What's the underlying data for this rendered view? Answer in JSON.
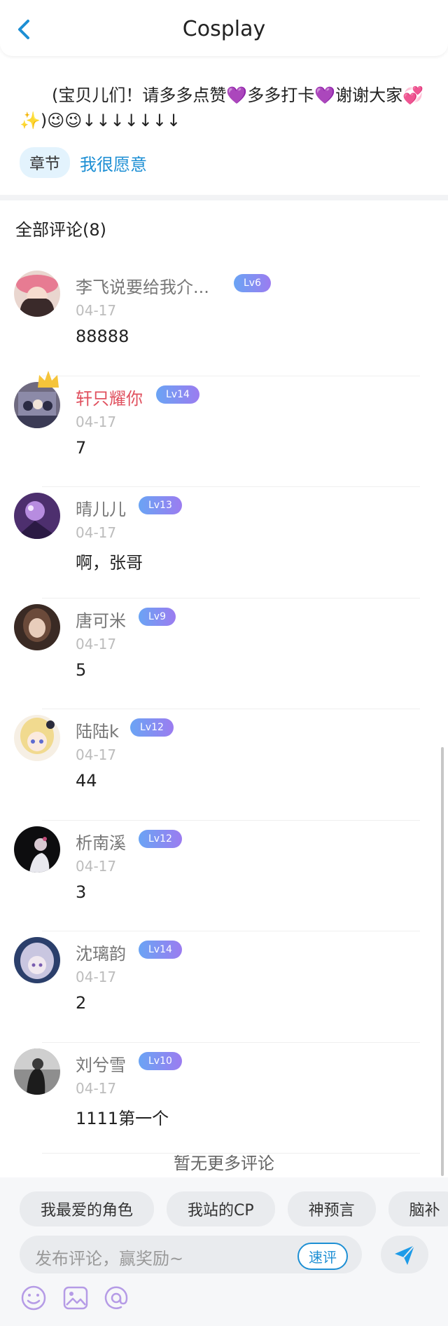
{
  "header": {
    "title": "Cosplay"
  },
  "post": {
    "text": "(宝贝儿们！请多多点赞💜多多打卡💜谢谢大家💞✨)😉😉↓↓↓↓↓↓↓",
    "chapter_label": "章节",
    "chapter_name": "我很愿意"
  },
  "comments_title": "全部评论(8)",
  "comments": [
    {
      "name": "李飞说要给我介...",
      "level": "Lv6",
      "date": "04-17",
      "text": "88888"
    },
    {
      "name": "轩只耀你",
      "level": "Lv14",
      "date": "04-17",
      "text": "7"
    },
    {
      "name": "晴儿儿",
      "level": "Lv13",
      "date": "04-17",
      "text": "啊，张哥"
    },
    {
      "name": "唐可米",
      "level": "Lv9",
      "date": "04-17",
      "text": "5"
    },
    {
      "name": "陆陆k",
      "level": "Lv12",
      "date": "04-17",
      "text": "44"
    },
    {
      "name": "析南溪",
      "level": "Lv12",
      "date": "04-17",
      "text": "3"
    },
    {
      "name": "沈璃韵",
      "level": "Lv14",
      "date": "04-17",
      "text": "2"
    },
    {
      "name": "刘兮雪",
      "level": "Lv10",
      "date": "04-17",
      "text": "1111第一个"
    }
  ],
  "no_more": "暂无更多评论",
  "quick_tags": [
    "我最爱的角色",
    "我站的CP",
    "神预言",
    "脑补"
  ],
  "input": {
    "placeholder": "发布评论，赢奖励~",
    "quick_label": "速评"
  },
  "colors": {
    "accent": "#1d8fd4",
    "vip_name": "#e0515f",
    "tool_purple": "#b59be6"
  }
}
